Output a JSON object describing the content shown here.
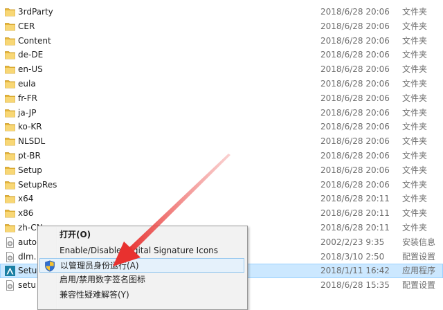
{
  "files": [
    {
      "name": "3rdParty",
      "date": "2018/6/28 20:06",
      "type": "文件夹",
      "icon": "folder-icon"
    },
    {
      "name": "CER",
      "date": "2018/6/28 20:06",
      "type": "文件夹",
      "icon": "folder-icon"
    },
    {
      "name": "Content",
      "date": "2018/6/28 20:06",
      "type": "文件夹",
      "icon": "folder-icon"
    },
    {
      "name": "de-DE",
      "date": "2018/6/28 20:06",
      "type": "文件夹",
      "icon": "folder-icon"
    },
    {
      "name": "en-US",
      "date": "2018/6/28 20:06",
      "type": "文件夹",
      "icon": "folder-icon"
    },
    {
      "name": "eula",
      "date": "2018/6/28 20:06",
      "type": "文件夹",
      "icon": "folder-icon"
    },
    {
      "name": "fr-FR",
      "date": "2018/6/28 20:06",
      "type": "文件夹",
      "icon": "folder-icon"
    },
    {
      "name": "ja-JP",
      "date": "2018/6/28 20:06",
      "type": "文件夹",
      "icon": "folder-icon"
    },
    {
      "name": "ko-KR",
      "date": "2018/6/28 20:06",
      "type": "文件夹",
      "icon": "folder-icon"
    },
    {
      "name": "NLSDL",
      "date": "2018/6/28 20:06",
      "type": "文件夹",
      "icon": "folder-icon"
    },
    {
      "name": "pt-BR",
      "date": "2018/6/28 20:06",
      "type": "文件夹",
      "icon": "folder-icon"
    },
    {
      "name": "Setup",
      "date": "2018/6/28 20:06",
      "type": "文件夹",
      "icon": "folder-icon"
    },
    {
      "name": "SetupRes",
      "date": "2018/6/28 20:06",
      "type": "文件夹",
      "icon": "folder-icon"
    },
    {
      "name": "x64",
      "date": "2018/6/28 20:11",
      "type": "文件夹",
      "icon": "folder-icon"
    },
    {
      "name": "x86",
      "date": "2018/6/28 20:11",
      "type": "文件夹",
      "icon": "folder-icon"
    },
    {
      "name": "zh-CN",
      "date": "2018/6/28 20:11",
      "type": "文件夹",
      "icon": "folder-icon"
    },
    {
      "name": "auto",
      "date": "2002/2/23 9:35",
      "type": "安装信息",
      "icon": "settings-file-icon"
    },
    {
      "name": "dlm.",
      "date": "2018/3/10 2:50",
      "type": "配置设置",
      "icon": "settings-file-icon"
    },
    {
      "name": "Setu",
      "date": "2018/1/11 16:42",
      "type": "应用程序",
      "icon": "autodesk-app-icon",
      "selected": true
    },
    {
      "name": "setu",
      "date": "2018/6/28 15:35",
      "type": "配置设置",
      "icon": "settings-file-icon"
    }
  ],
  "context_menu": {
    "items": [
      {
        "label": "打开(O)",
        "bold": true
      },
      {
        "label": "Enable/Disable Digital Signature Icons"
      },
      {
        "label": "以管理员身份运行(A)",
        "icon": "uac-shield-icon",
        "hover": true
      },
      {
        "label": "启用/禁用数字签名图标"
      },
      {
        "label": "兼容性疑难解答(Y)"
      }
    ]
  },
  "colors": {
    "selection": "#cce8ff",
    "menu_hover": "#e5f1fb",
    "folder": "#f5c84a",
    "arrow": "#e8312f"
  }
}
